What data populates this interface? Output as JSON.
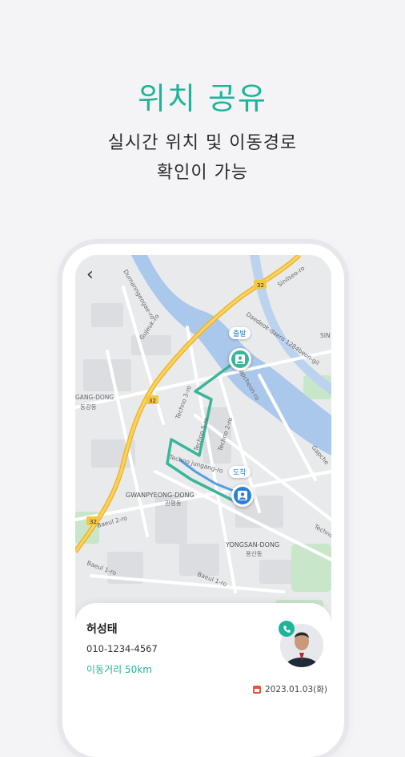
{
  "header": {
    "title": "위치 공유",
    "subtitle_line1": "실시간 위치 및 이동경로",
    "subtitle_line2": "확인이 가능"
  },
  "map": {
    "labels": {
      "gang_dong": "GANG-DONG",
      "gang_dong_kr": "동강동",
      "gwanpyeong": "GWANPYEONG-DONG",
      "gwanpyeong_kr": "관평동",
      "yongsan": "YONGSAN-DONG",
      "yongsan_kr": "용산동",
      "sin": "SIN",
      "road_32_a": "32",
      "road_32_b": "32",
      "road_32_c": "32",
      "baeul2": "Baeul 2-ro",
      "baeul1": "Baeul 1-ro",
      "baeul1b": "Baeul 1-ro",
      "techno5": "Techno 5-ro",
      "techno2": "Techno 2-ro",
      "techno3": "Techno 3-ro",
      "techno_jungang": "Techno jungang-ro",
      "techno": "Techno",
      "gapcheon": "Gapcheon-ro",
      "gapcheon_b": "Gapche",
      "daedeok": "Daedeok-daero 1284beon-gil",
      "sinilseo": "Sinilseo-ro",
      "gujeuk": "Gujeuk-ro",
      "dumanngeogae": "Dumanngeogae-ro"
    },
    "start_label": "출발",
    "end_label": "도착",
    "route_color": "#3bb59a",
    "pin_color": "#2b7fd8"
  },
  "card": {
    "name": "허성태",
    "phone": "010-1234-4567",
    "distance": "이동거리 50km",
    "date": "2023.01.03(화)"
  },
  "colors": {
    "accent": "#1db59a",
    "background": "#f4f4f6",
    "water": "#aac7ec",
    "highway": "#f5c63f",
    "park": "#c8e6c9"
  }
}
